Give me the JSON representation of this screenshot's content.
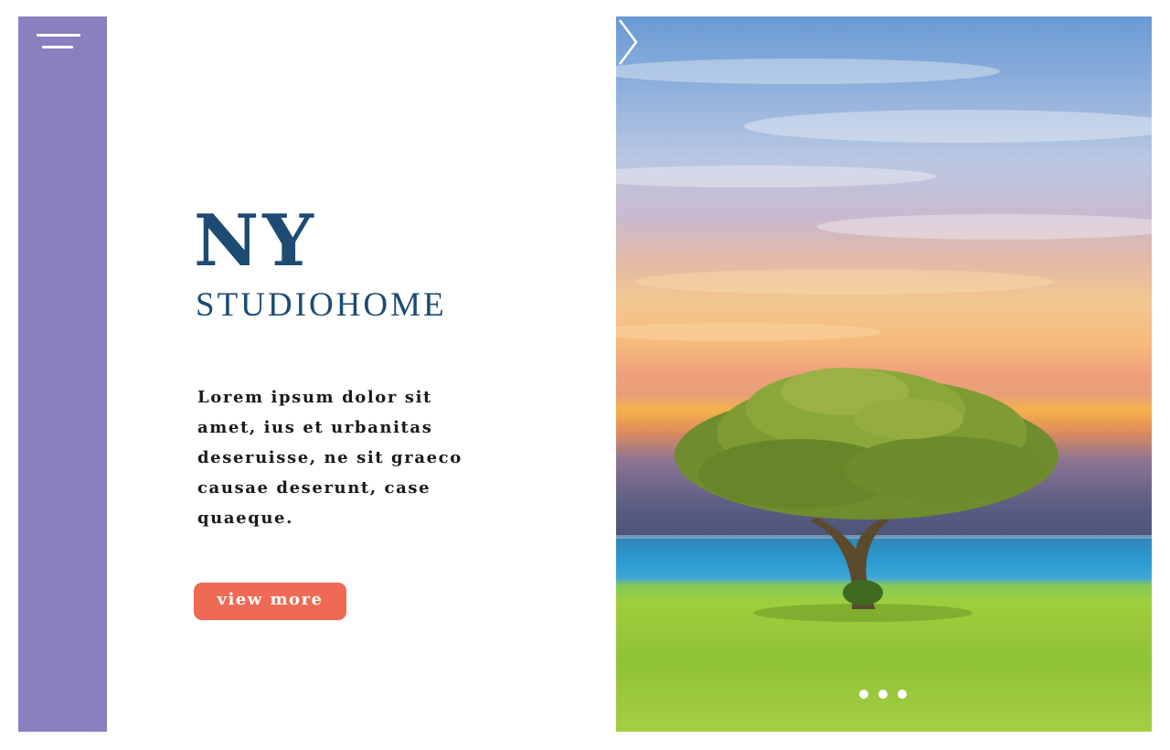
{
  "sidebar": {
    "menu_icon": "hamburger-menu-icon",
    "color": "#8a80bf"
  },
  "hero_text": {
    "title": "NY",
    "subtitle": "STUDIOHOME",
    "description": "Lorem ipsum dolor sit amet, ius et urbanitas deseruisse, ne sit graeco causae deserunt, case quaeque.",
    "cta_label": "view more",
    "title_color": "#1d4b73",
    "cta_color": "#ee6a55"
  },
  "slider": {
    "next_icon": "chevron-right-icon",
    "indicator_count": 3,
    "active_index": 0
  }
}
